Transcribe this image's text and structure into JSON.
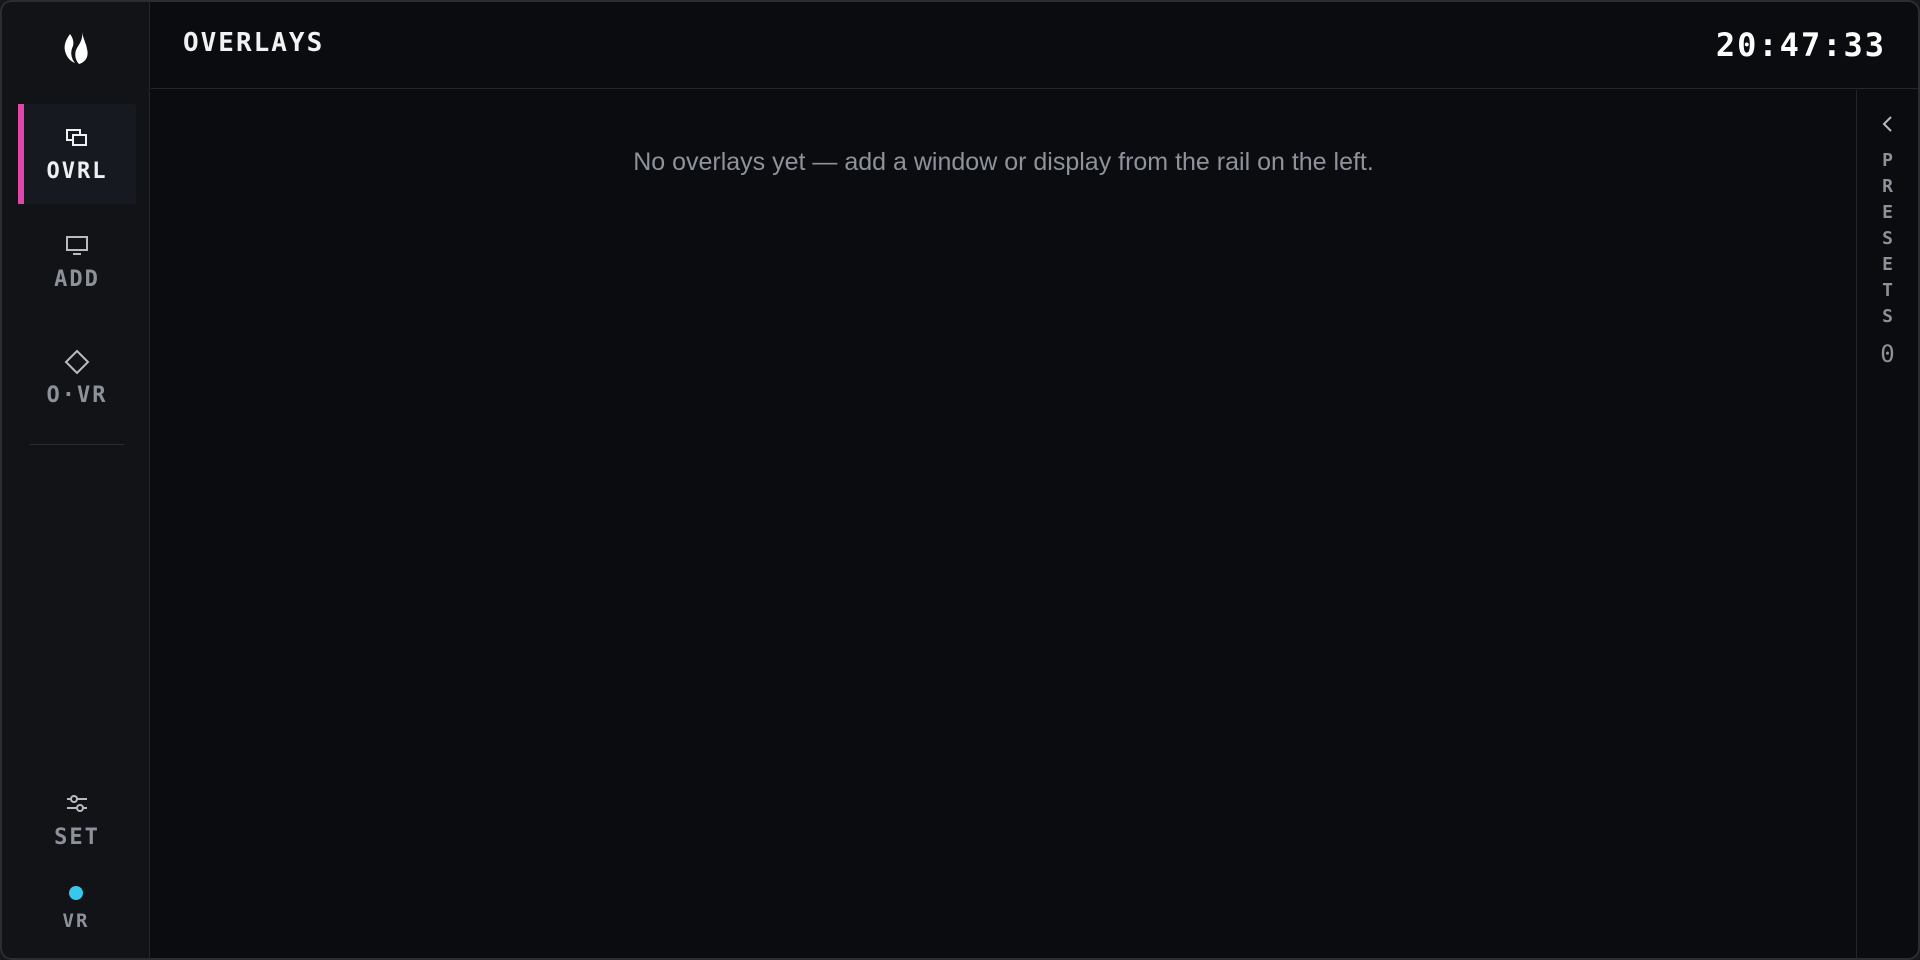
{
  "header": {
    "title": "OVERLAYS",
    "clock": "20:47:33"
  },
  "rail": {
    "logo_icon": "flame-logo-icon",
    "items": [
      {
        "label": "OVRL",
        "icon": "overlays-icon",
        "active": true
      },
      {
        "label": "ADD",
        "icon": "monitor-icon",
        "active": false
      },
      {
        "label": "O·VR",
        "icon": "diamond-icon",
        "active": false
      },
      {
        "label": "SET",
        "icon": "sliders-icon",
        "active": false
      }
    ],
    "vr_status": {
      "label": "VR",
      "color": "#38c8ee"
    },
    "accent_color": "#e147a9"
  },
  "main": {
    "empty_message": "No overlays yet — add a window or display from the rail on the left."
  },
  "presets": {
    "label": "PRESETS",
    "count": "0",
    "toggle_icon": "chevron-left-icon"
  }
}
